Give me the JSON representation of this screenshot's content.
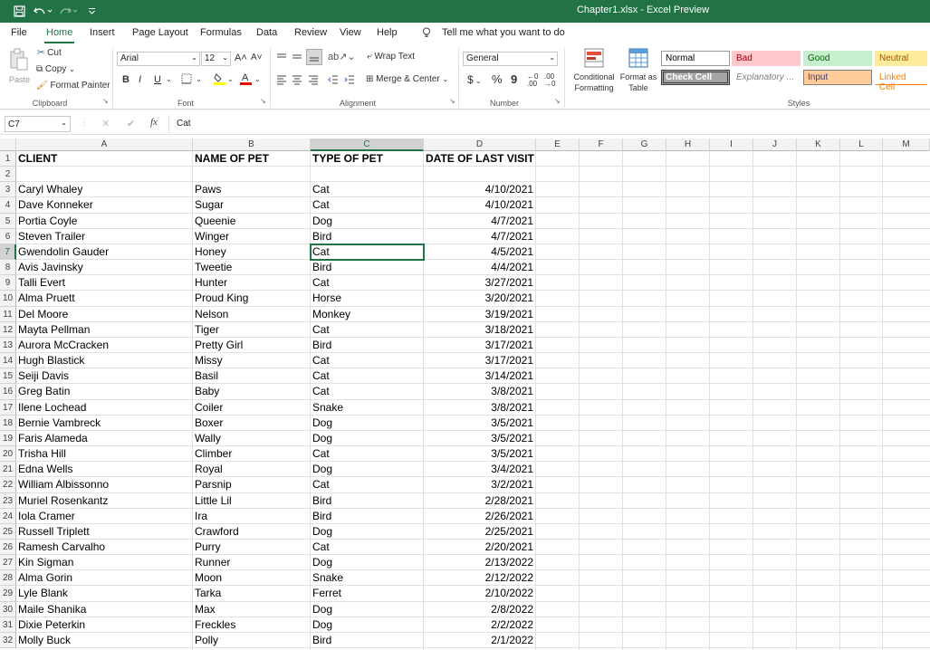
{
  "titlebar": {
    "title": "Chapter1.xlsx  -  Excel Preview",
    "save_icon": "save-icon",
    "undo_icon": "undo-icon",
    "redo_icon": "redo-icon"
  },
  "tabs": [
    "File",
    "Home",
    "Insert",
    "Page Layout",
    "Formulas",
    "Data",
    "Review",
    "View",
    "Help"
  ],
  "active_tab": "Home",
  "tell_me": "Tell me what you want to do",
  "ribbon": {
    "clipboard": {
      "paste": "Paste",
      "cut": "Cut",
      "copy": "Copy",
      "format_painter": "Format Painter",
      "label": "Clipboard"
    },
    "font": {
      "name": "Arial",
      "size": "12",
      "bold": "B",
      "italic": "I",
      "underline": "U",
      "grow": "A˄",
      "shrink": "A˅",
      "label": "Font"
    },
    "alignment": {
      "wrap_text": "Wrap Text",
      "merge_center": "Merge & Center",
      "label": "Alignment"
    },
    "number": {
      "format": "General",
      "currency": "$",
      "percent": "%",
      "comma": "9",
      "label": "Number"
    },
    "styles": {
      "conditional": "Conditional Formatting",
      "format_as_table": "Format as Table",
      "label": "Styles",
      "items": [
        {
          "label": "Normal",
          "bg": "#ffffff",
          "fg": "#000000",
          "border": "#999999"
        },
        {
          "label": "Bad",
          "bg": "#ffc7ce",
          "fg": "#9c0006",
          "border": "#ffc7ce"
        },
        {
          "label": "Good",
          "bg": "#c6efce",
          "fg": "#006100",
          "border": "#c6efce"
        },
        {
          "label": "Neutral",
          "bg": "#ffeb9c",
          "fg": "#9c5700",
          "border": "#ffeb9c"
        },
        {
          "label": "Check Cell",
          "bg": "#a5a5a5",
          "fg": "#ffffff",
          "border": "#3f3f3f"
        },
        {
          "label": "Explanatory ...",
          "bg": "#ffffff",
          "fg": "#7f7f7f",
          "border": "#ffffff"
        },
        {
          "label": "Input",
          "bg": "#ffcc99",
          "fg": "#3f3f76",
          "border": "#7f7f7f"
        },
        {
          "label": "Linked Cell",
          "bg": "#ffffff",
          "fg": "#fa7d00",
          "border": "#ffffff"
        }
      ]
    }
  },
  "formula_bar": {
    "name_box": "C7",
    "cancel": "✕",
    "enter": "✔",
    "fx": "fx",
    "value": "Cat"
  },
  "columns": [
    "A",
    "B",
    "C",
    "D",
    "E",
    "F",
    "G",
    "H",
    "I",
    "J",
    "K",
    "L",
    "M"
  ],
  "active_cell": {
    "row": 7,
    "col": "C"
  },
  "rows": [
    {
      "n": "1",
      "a": "CLIENT",
      "b": "NAME OF PET",
      "c": "TYPE OF PET",
      "d": "DATE OF LAST VISIT",
      "header": true
    },
    {
      "n": "2",
      "a": "",
      "b": "",
      "c": "",
      "d": ""
    },
    {
      "n": "3",
      "a": "Caryl Whaley",
      "b": "Paws",
      "c": "Cat",
      "d": "4/10/2021"
    },
    {
      "n": "4",
      "a": "Dave Konneker",
      "b": "Sugar",
      "c": "Cat",
      "d": "4/10/2021"
    },
    {
      "n": "5",
      "a": "Portia Coyle",
      "b": "Queenie",
      "c": "Dog",
      "d": "4/7/2021"
    },
    {
      "n": "6",
      "a": "Steven Trailer",
      "b": "Winger",
      "c": "Bird",
      "d": "4/7/2021"
    },
    {
      "n": "7",
      "a": "Gwendolin Gauder",
      "b": "Honey",
      "c": "Cat",
      "d": "4/5/2021"
    },
    {
      "n": "8",
      "a": "Avis Javinsky",
      "b": "Tweetie",
      "c": "Bird",
      "d": "4/4/2021"
    },
    {
      "n": "9",
      "a": "Talli Evert",
      "b": "Hunter",
      "c": "Cat",
      "d": "3/27/2021"
    },
    {
      "n": "10",
      "a": "Alma Pruett",
      "b": "Proud King",
      "c": "Horse",
      "d": "3/20/2021"
    },
    {
      "n": "11",
      "a": "Del Moore",
      "b": "Nelson",
      "c": "Monkey",
      "d": "3/19/2021"
    },
    {
      "n": "12",
      "a": "Mayta Pellman",
      "b": "Tiger",
      "c": "Cat",
      "d": "3/18/2021"
    },
    {
      "n": "13",
      "a": "Aurora McCracken",
      "b": "Pretty Girl",
      "c": "Bird",
      "d": "3/17/2021"
    },
    {
      "n": "14",
      "a": "Hugh Blastick",
      "b": "Missy",
      "c": "Cat",
      "d": "3/17/2021"
    },
    {
      "n": "15",
      "a": "Seiji Davis",
      "b": "Basil",
      "c": "Cat",
      "d": "3/14/2021"
    },
    {
      "n": "16",
      "a": "Greg Batin",
      "b": "Baby",
      "c": "Cat",
      "d": "3/8/2021"
    },
    {
      "n": "17",
      "a": "Ilene Lochead",
      "b": "Coiler",
      "c": "Snake",
      "d": "3/8/2021"
    },
    {
      "n": "18",
      "a": "Bernie Vambreck",
      "b": "Boxer",
      "c": "Dog",
      "d": "3/5/2021"
    },
    {
      "n": "19",
      "a": "Faris Alameda",
      "b": "Wally",
      "c": "Dog",
      "d": "3/5/2021"
    },
    {
      "n": "20",
      "a": "Trisha Hill",
      "b": "Climber",
      "c": "Cat",
      "d": "3/5/2021"
    },
    {
      "n": "21",
      "a": "Edna Wells",
      "b": "Royal",
      "c": "Dog",
      "d": "3/4/2021"
    },
    {
      "n": "22",
      "a": "William Albissonno",
      "b": "Parsnip",
      "c": "Cat",
      "d": "3/2/2021"
    },
    {
      "n": "23",
      "a": "Muriel Rosenkantz",
      "b": "Little Lil",
      "c": "Bird",
      "d": "2/28/2021"
    },
    {
      "n": "24",
      "a": "Iola Cramer",
      "b": "Ira",
      "c": "Bird",
      "d": "2/26/2021"
    },
    {
      "n": "25",
      "a": "Russell Triplett",
      "b": "Crawford",
      "c": "Dog",
      "d": "2/25/2021"
    },
    {
      "n": "26",
      "a": "Ramesh Carvalho",
      "b": "Purry",
      "c": "Cat",
      "d": "2/20/2021"
    },
    {
      "n": "27",
      "a": "Kin Sigman",
      "b": "Runner",
      "c": "Dog",
      "d": "2/13/2022"
    },
    {
      "n": "28",
      "a": "Alma Gorin",
      "b": "Moon",
      "c": "Snake",
      "d": "2/12/2022"
    },
    {
      "n": "29",
      "a": "Lyle Blank",
      "b": "Tarka",
      "c": "Ferret",
      "d": "2/10/2022"
    },
    {
      "n": "30",
      "a": "Maile Shanika",
      "b": "Max",
      "c": "Dog",
      "d": "2/8/2022"
    },
    {
      "n": "31",
      "a": "Dixie Peterkin",
      "b": "Freckles",
      "c": "Dog",
      "d": "2/2/2022"
    },
    {
      "n": "32",
      "a": "Molly Buck",
      "b": "Polly",
      "c": "Bird",
      "d": "2/1/2022"
    }
  ]
}
